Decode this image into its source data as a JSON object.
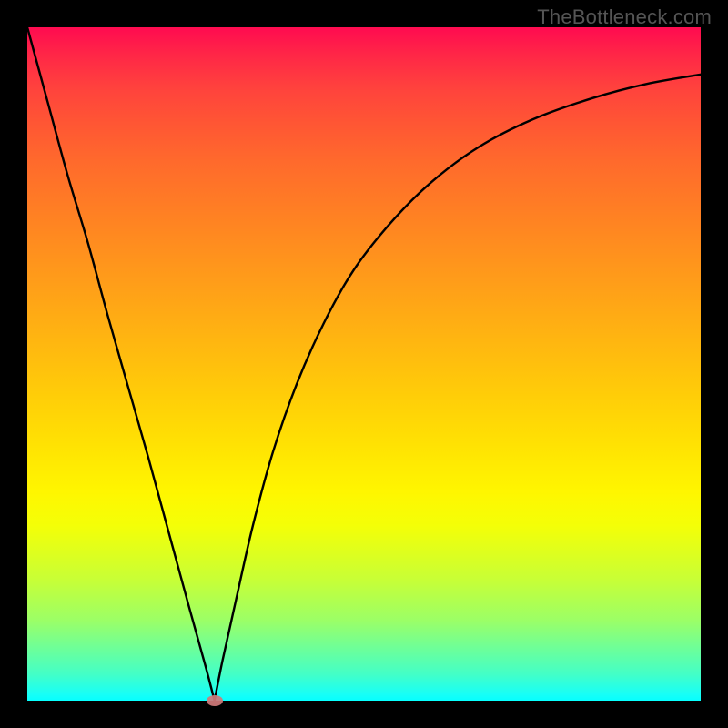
{
  "watermark": "TheBottleneck.com",
  "chart_data": {
    "type": "line",
    "title": "",
    "xlabel": "",
    "ylabel": "",
    "xlim": [
      0,
      100
    ],
    "ylim": [
      0,
      100
    ],
    "minimum_point": {
      "x": 27.8,
      "y": 0
    },
    "series": [
      {
        "name": "v-curve",
        "x": [
          0,
          3,
          6,
          9,
          12,
          15,
          18,
          21,
          24,
          26.5,
          27.8,
          29,
          31,
          33.5,
          36.5,
          40,
          44,
          48.5,
          54,
          60,
          67,
          75,
          84,
          92,
          100
        ],
        "values": [
          100,
          89,
          78,
          68,
          57,
          46.5,
          36,
          25,
          14,
          5,
          0,
          6,
          15,
          26,
          37,
          47,
          56,
          64,
          71,
          77,
          82.2,
          86.3,
          89.5,
          91.6,
          93
        ]
      }
    ],
    "marker": {
      "x": 27.8,
      "y": 0,
      "color": "#cf7a7a"
    },
    "colors": {
      "curve": "#000000",
      "frame_bg": "#000000",
      "gradient_top": "#ff0b50",
      "gradient_bottom": "#05ffff"
    }
  }
}
